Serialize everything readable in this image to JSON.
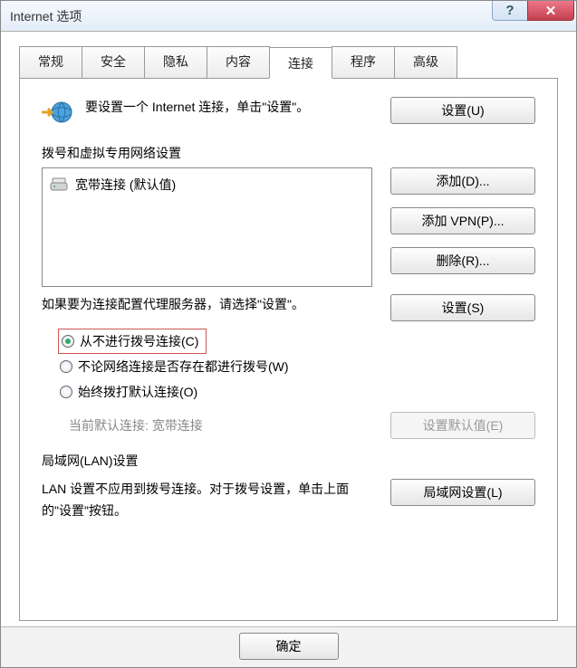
{
  "titlebar": {
    "title": "Internet 选项",
    "help": "?",
    "close": "✕"
  },
  "tabs": {
    "items": [
      {
        "label": "常规"
      },
      {
        "label": "安全"
      },
      {
        "label": "隐私"
      },
      {
        "label": "内容"
      },
      {
        "label": "连接"
      },
      {
        "label": "程序"
      },
      {
        "label": "高级"
      }
    ],
    "active_index": 4
  },
  "setup": {
    "text": "要设置一个 Internet 连接，单击\"设置\"。",
    "button": "设置(U)"
  },
  "dialup": {
    "title": "拨号和虚拟专用网络设置",
    "items": [
      {
        "label": "宽带连接 (默认值)"
      }
    ],
    "buttons": {
      "add": "添加(D)...",
      "add_vpn": "添加 VPN(P)...",
      "remove": "删除(R)..."
    },
    "proxy_text": "如果要为连接配置代理服务器，请选择\"设置\"。",
    "proxy_button": "设置(S)",
    "radios": {
      "never": "从不进行拨号连接(C)",
      "whenever": "不论网络连接是否存在都进行拨号(W)",
      "always": "始终拨打默认连接(O)"
    },
    "default_label": "当前默认连接: 宽带连接",
    "default_button": "设置默认值(E)"
  },
  "lan": {
    "title": "局域网(LAN)设置",
    "text": "LAN 设置不应用到拨号连接。对于拨号设置，单击上面的\"设置\"按钮。",
    "button": "局域网设置(L)"
  },
  "footer": {
    "ok": "确定"
  }
}
